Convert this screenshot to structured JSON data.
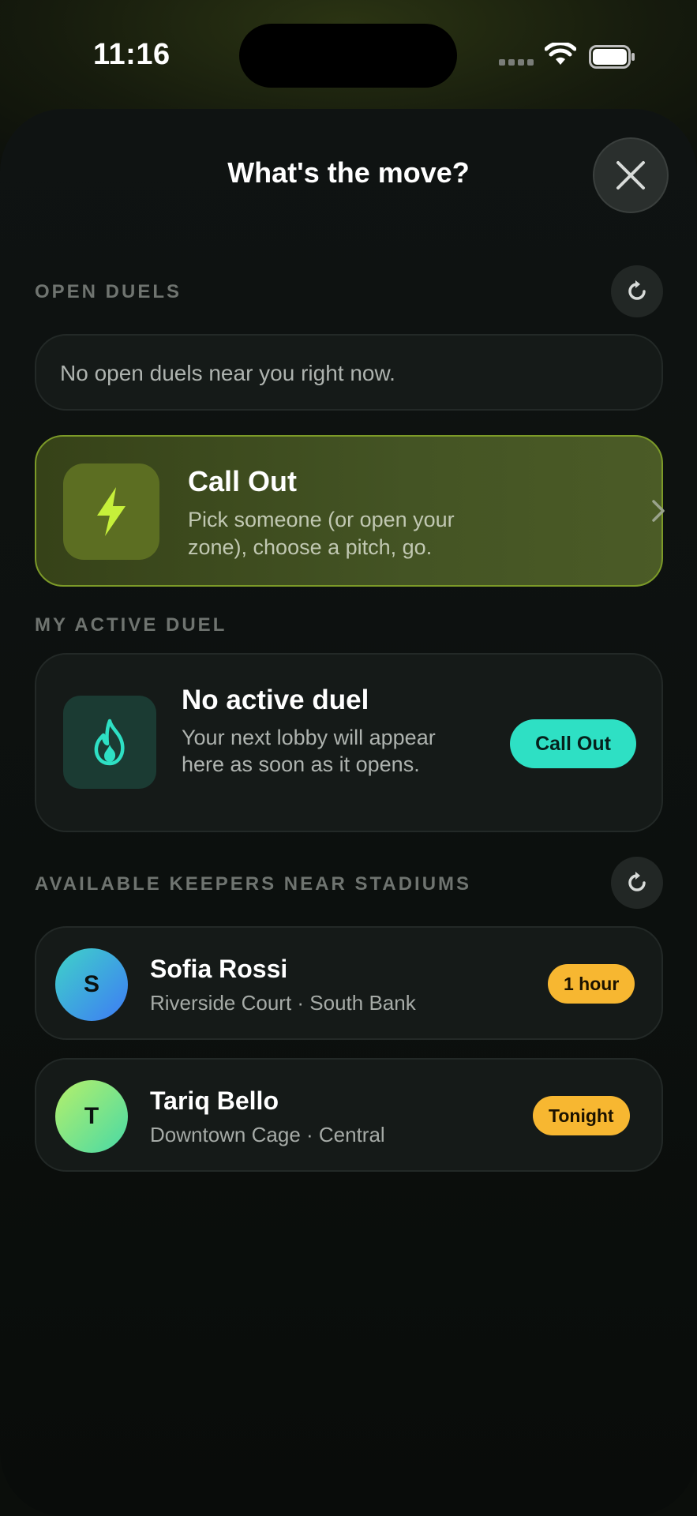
{
  "status_bar": {
    "time": "11:16"
  },
  "sheet": {
    "title": "What's the move?"
  },
  "open_duels": {
    "label": "OPEN DUELS",
    "empty_text": "No open duels near you right now."
  },
  "callout_card": {
    "title": "Call Out",
    "description": "Pick someone (or open your zone), choose a pitch, go."
  },
  "active_duel": {
    "label": "MY ACTIVE DUEL",
    "title": "No active duel",
    "description": "Your next lobby will appear here as soon as it opens.",
    "button_label": "Call Out"
  },
  "keepers": {
    "label": "AVAILABLE KEEPERS NEAR STADIUMS",
    "items": [
      {
        "initial": "S",
        "name": "Sofia Rossi",
        "location": "Riverside Court · South Bank",
        "availability": "1 hour"
      },
      {
        "initial": "T",
        "name": "Tariq Bello",
        "location": "Downtown Cage · Central",
        "availability": "Tonight"
      }
    ]
  },
  "colors": {
    "accent_teal": "#2ee0c4",
    "accent_lime": "#c6f03a",
    "badge_amber": "#f7b731"
  }
}
